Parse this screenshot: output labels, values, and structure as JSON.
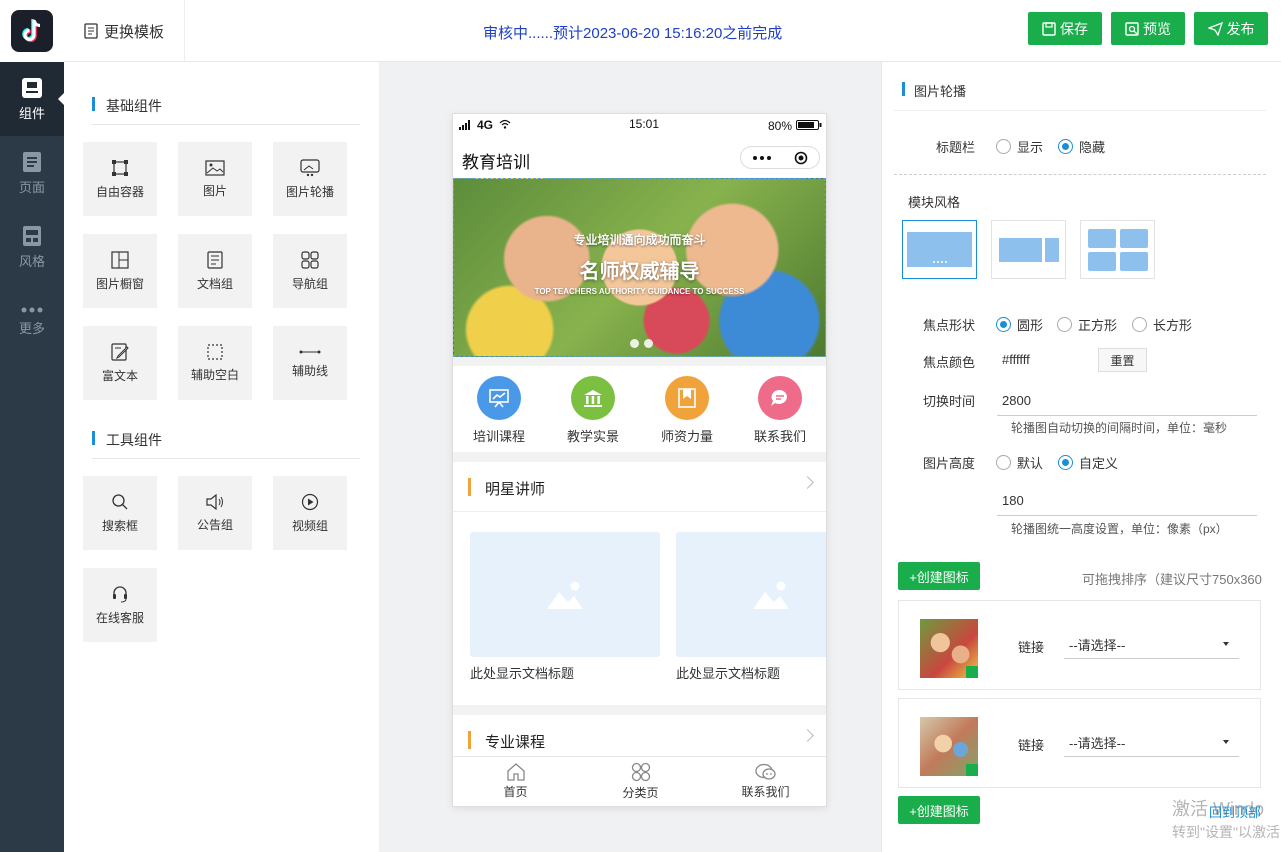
{
  "app": {
    "logo": "tiktok-logo"
  },
  "rail": [
    {
      "label": "组件",
      "icon": "component-icon",
      "active": true
    },
    {
      "label": "页面",
      "icon": "page-icon",
      "active": false
    },
    {
      "label": "风格",
      "icon": "style-icon",
      "active": false
    },
    {
      "label": "更多",
      "icon": "more-icon",
      "active": false
    }
  ],
  "topbar": {
    "template_btn": "更换模板",
    "review_status": "审核中......预计2023-06-20 15:16:20之前完成",
    "save": "保存",
    "preview": "预览",
    "publish": "发布"
  },
  "components": {
    "basic_title": "基础组件",
    "basic": [
      "自由容器",
      "图片",
      "图片轮播",
      "图片橱窗",
      "文档组",
      "导航组",
      "富文本",
      "辅助空白",
      "辅助线"
    ],
    "tools_title": "工具组件",
    "tools": [
      "搜索框",
      "公告组",
      "视频组",
      "在线客服"
    ]
  },
  "phone": {
    "status": {
      "signal": "4G",
      "time": "15:01",
      "battery": "80%"
    },
    "title": "教育培训",
    "banner": {
      "line1": "专业培训通向成功而奋斗",
      "line2": "名师权威辅导",
      "line3": "TOP TEACHERS AUTHORITY GUIDANCE TO SUCCESS"
    },
    "nav": [
      {
        "label": "培训课程",
        "color": "#4a98e8"
      },
      {
        "label": "教学实景",
        "color": "#7cc042"
      },
      {
        "label": "师资力量",
        "color": "#f0a33b"
      },
      {
        "label": "联系我们",
        "color": "#ee6b8a"
      }
    ],
    "section1": "明星讲师",
    "card_caption": "此处显示文档标题",
    "section2": "专业课程",
    "tabs": [
      "首页",
      "分类页",
      "联系我们"
    ]
  },
  "settings": {
    "title": "图片轮播",
    "title_bar_label": "标题栏",
    "show": "显示",
    "hide": "隐藏",
    "module_style": "模块风格",
    "focus_shape_label": "焦点形状",
    "shape_circle": "圆形",
    "shape_square": "正方形",
    "shape_rect": "长方形",
    "focus_color_label": "焦点颜色",
    "focus_color": "#ffffff",
    "reset": "重置",
    "switch_time_label": "切换时间",
    "switch_time": "2800",
    "switch_hint": "轮播图自动切换的间隔时间，单位：毫秒",
    "height_label": "图片高度",
    "height_default": "默认",
    "height_custom": "自定义",
    "height_value": "180",
    "height_hint": "轮播图统一高度设置，单位：像素（px）",
    "create_icon": "+创建图标",
    "drag_hint": "可拖拽排序（建议尺寸750x360",
    "link_label": "链接",
    "link_placeholder": "--请选择--",
    "back_top": "回到顶部",
    "watermark1": "激活 Windo",
    "watermark2": "转到\"设置\"以激活"
  }
}
